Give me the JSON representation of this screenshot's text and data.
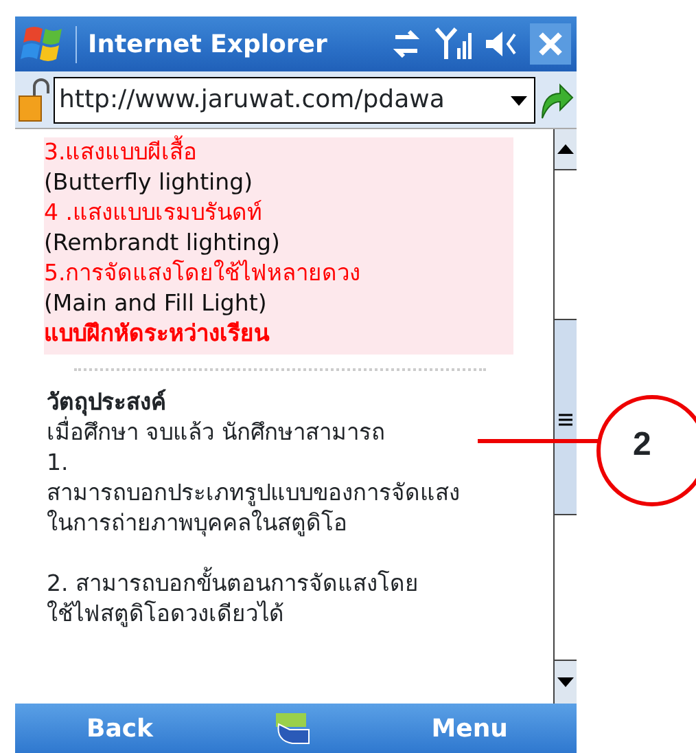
{
  "title_bar": {
    "title": "Internet Explorer"
  },
  "address_bar": {
    "url": "http://www.jaruwat.com/pdawa"
  },
  "highlight_lines": [
    {
      "kind": "red",
      "text": "3.แสงแบบผีเสื้อ"
    },
    {
      "kind": "black",
      "text": "(Butterfly lighting)"
    },
    {
      "kind": "red",
      "text": "4 .แสงแบบเรมบรันดท์"
    },
    {
      "kind": "black",
      "text": "(Rembrandt lighting)"
    },
    {
      "kind": "red",
      "text": "5.การจัดแสงโดยใช้ไฟหลายดวง"
    },
    {
      "kind": "black",
      "text": "(Main and Fill Light)"
    },
    {
      "kind": "red-bold",
      "text": "แบบฝึกหัดระหว่างเรียน"
    }
  ],
  "section": {
    "heading": "วัตถุประสงค์",
    "lines": [
      {
        "kind": "line",
        "text": "เมื่อศึกษา จบแล้ว นักศึกษาสามารถ"
      },
      {
        "kind": "line",
        "text": "1."
      },
      {
        "kind": "line",
        "text": "สามารถบอกประเภทรูปแบบของการจัดแสง"
      },
      {
        "kind": "line",
        "text": "ในการถ่ายภาพบุคคลในสตูดิโอ"
      },
      {
        "kind": "gap"
      },
      {
        "kind": "line",
        "text": "2. สามารถบอกขั้นตอนการจัดแสงโดย"
      },
      {
        "kind": "line",
        "text": "ใช้ไฟสตูดิโอดวงเดียวได้"
      }
    ]
  },
  "soft_keys": {
    "left": "Back",
    "right": "Menu"
  },
  "callout": {
    "label": "2"
  }
}
